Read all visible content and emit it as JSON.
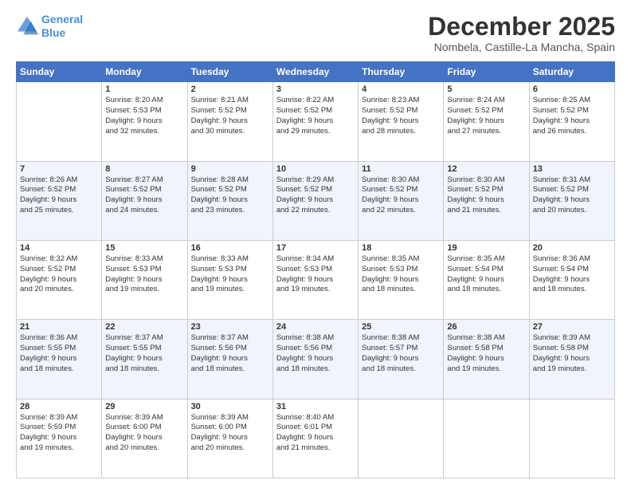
{
  "logo": {
    "line1": "General",
    "line2": "Blue"
  },
  "title": "December 2025",
  "subtitle": "Nombela, Castille-La Mancha, Spain",
  "days_of_week": [
    "Sunday",
    "Monday",
    "Tuesday",
    "Wednesday",
    "Thursday",
    "Friday",
    "Saturday"
  ],
  "weeks": [
    [
      {
        "day": "",
        "info": ""
      },
      {
        "day": "1",
        "info": "Sunrise: 8:20 AM\nSunset: 5:53 PM\nDaylight: 9 hours\nand 32 minutes."
      },
      {
        "day": "2",
        "info": "Sunrise: 8:21 AM\nSunset: 5:52 PM\nDaylight: 9 hours\nand 30 minutes."
      },
      {
        "day": "3",
        "info": "Sunrise: 8:22 AM\nSunset: 5:52 PM\nDaylight: 9 hours\nand 29 minutes."
      },
      {
        "day": "4",
        "info": "Sunrise: 8:23 AM\nSunset: 5:52 PM\nDaylight: 9 hours\nand 28 minutes."
      },
      {
        "day": "5",
        "info": "Sunrise: 8:24 AM\nSunset: 5:52 PM\nDaylight: 9 hours\nand 27 minutes."
      },
      {
        "day": "6",
        "info": "Sunrise: 8:25 AM\nSunset: 5:52 PM\nDaylight: 9 hours\nand 26 minutes."
      }
    ],
    [
      {
        "day": "7",
        "info": "Sunrise: 8:26 AM\nSunset: 5:52 PM\nDaylight: 9 hours\nand 25 minutes."
      },
      {
        "day": "8",
        "info": "Sunrise: 8:27 AM\nSunset: 5:52 PM\nDaylight: 9 hours\nand 24 minutes."
      },
      {
        "day": "9",
        "info": "Sunrise: 8:28 AM\nSunset: 5:52 PM\nDaylight: 9 hours\nand 23 minutes."
      },
      {
        "day": "10",
        "info": "Sunrise: 8:29 AM\nSunset: 5:52 PM\nDaylight: 9 hours\nand 22 minutes."
      },
      {
        "day": "11",
        "info": "Sunrise: 8:30 AM\nSunset: 5:52 PM\nDaylight: 9 hours\nand 22 minutes."
      },
      {
        "day": "12",
        "info": "Sunrise: 8:30 AM\nSunset: 5:52 PM\nDaylight: 9 hours\nand 21 minutes."
      },
      {
        "day": "13",
        "info": "Sunrise: 8:31 AM\nSunset: 5:52 PM\nDaylight: 9 hours\nand 20 minutes."
      }
    ],
    [
      {
        "day": "14",
        "info": "Sunrise: 8:32 AM\nSunset: 5:52 PM\nDaylight: 9 hours\nand 20 minutes."
      },
      {
        "day": "15",
        "info": "Sunrise: 8:33 AM\nSunset: 5:53 PM\nDaylight: 9 hours\nand 19 minutes."
      },
      {
        "day": "16",
        "info": "Sunrise: 8:33 AM\nSunset: 5:53 PM\nDaylight: 9 hours\nand 19 minutes."
      },
      {
        "day": "17",
        "info": "Sunrise: 8:34 AM\nSunset: 5:53 PM\nDaylight: 9 hours\nand 19 minutes."
      },
      {
        "day": "18",
        "info": "Sunrise: 8:35 AM\nSunset: 5:53 PM\nDaylight: 9 hours\nand 18 minutes."
      },
      {
        "day": "19",
        "info": "Sunrise: 8:35 AM\nSunset: 5:54 PM\nDaylight: 9 hours\nand 18 minutes."
      },
      {
        "day": "20",
        "info": "Sunrise: 8:36 AM\nSunset: 5:54 PM\nDaylight: 9 hours\nand 18 minutes."
      }
    ],
    [
      {
        "day": "21",
        "info": "Sunrise: 8:36 AM\nSunset: 5:55 PM\nDaylight: 9 hours\nand 18 minutes."
      },
      {
        "day": "22",
        "info": "Sunrise: 8:37 AM\nSunset: 5:55 PM\nDaylight: 9 hours\nand 18 minutes."
      },
      {
        "day": "23",
        "info": "Sunrise: 8:37 AM\nSunset: 5:56 PM\nDaylight: 9 hours\nand 18 minutes."
      },
      {
        "day": "24",
        "info": "Sunrise: 8:38 AM\nSunset: 5:56 PM\nDaylight: 9 hours\nand 18 minutes."
      },
      {
        "day": "25",
        "info": "Sunrise: 8:38 AM\nSunset: 5:57 PM\nDaylight: 9 hours\nand 18 minutes."
      },
      {
        "day": "26",
        "info": "Sunrise: 8:38 AM\nSunset: 5:58 PM\nDaylight: 9 hours\nand 19 minutes."
      },
      {
        "day": "27",
        "info": "Sunrise: 8:39 AM\nSunset: 5:58 PM\nDaylight: 9 hours\nand 19 minutes."
      }
    ],
    [
      {
        "day": "28",
        "info": "Sunrise: 8:39 AM\nSunset: 5:59 PM\nDaylight: 9 hours\nand 19 minutes."
      },
      {
        "day": "29",
        "info": "Sunrise: 8:39 AM\nSunset: 6:00 PM\nDaylight: 9 hours\nand 20 minutes."
      },
      {
        "day": "30",
        "info": "Sunrise: 8:39 AM\nSunset: 6:00 PM\nDaylight: 9 hours\nand 20 minutes."
      },
      {
        "day": "31",
        "info": "Sunrise: 8:40 AM\nSunset: 6:01 PM\nDaylight: 9 hours\nand 21 minutes."
      },
      {
        "day": "",
        "info": ""
      },
      {
        "day": "",
        "info": ""
      },
      {
        "day": "",
        "info": ""
      }
    ]
  ]
}
